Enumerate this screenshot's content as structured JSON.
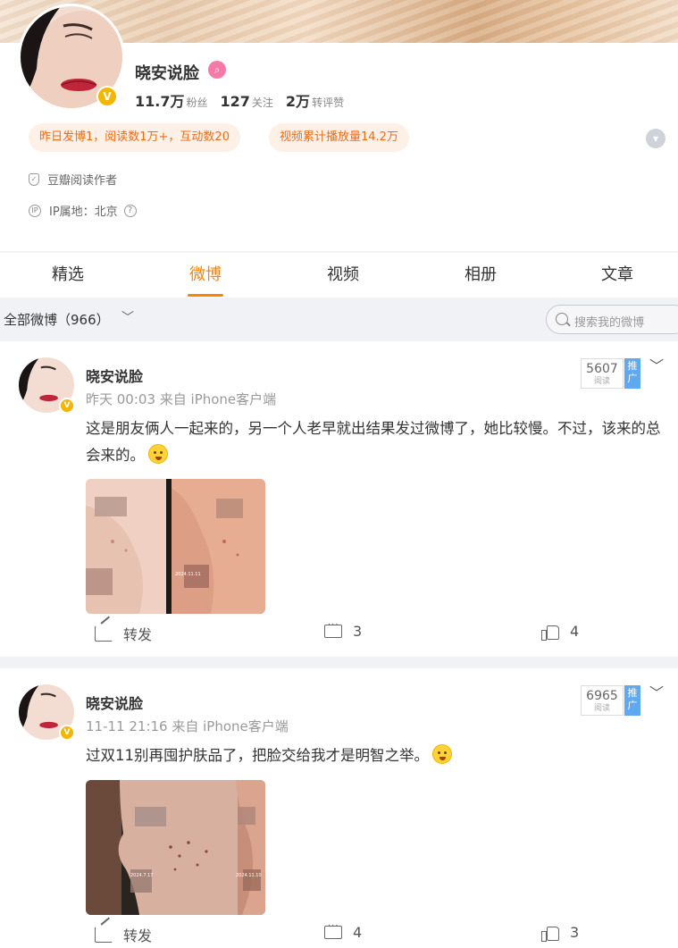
{
  "profile": {
    "name": "晓安说脸",
    "verified_badge": "V",
    "level_icon": "weibo-level-icon",
    "stats": [
      {
        "value": "11.7万",
        "label": "粉丝"
      },
      {
        "value": "127",
        "label": "关注"
      },
      {
        "value": "2万",
        "label": "转评赞"
      }
    ],
    "chips": [
      "昨日发博1，阅读数1万+，互动数20",
      "视频累计播放量14.2万"
    ],
    "info": [
      {
        "icon": "shield-icon",
        "text": "豆瓣阅读作者"
      },
      {
        "icon": "ip-icon",
        "text": "IP属地：北京",
        "help": "?"
      }
    ]
  },
  "tabs": [
    {
      "label": "精选",
      "active": false
    },
    {
      "label": "微博",
      "active": true
    },
    {
      "label": "视频",
      "active": false
    },
    {
      "label": "相册",
      "active": false
    },
    {
      "label": "文章",
      "active": false
    }
  ],
  "filter": {
    "label": "全部微博（966）",
    "chevron": "﹀",
    "search_placeholder": "搜索我的微博"
  },
  "posts": [
    {
      "author": "晓安说脸",
      "meta": "昨天 00:03 来自 iPhone客户端",
      "reads": "5607",
      "reads_label": "阅读",
      "promo": "推广",
      "text": "这是朋友俩人一起来的，另一个人老早就出结果发过微博了，她比较慢。不过，该来的总会来的。",
      "photo_labels": [
        "2024.11.11"
      ],
      "actions": {
        "share": "转发",
        "comments": "3",
        "likes": "4"
      }
    },
    {
      "author": "晓安说脸",
      "meta": "11-11 21:16 来自 iPhone客户端",
      "reads": "6965",
      "reads_label": "阅读",
      "promo": "推广",
      "text": "过双11别再囤护肤品了，把脸交给我才是明智之举。",
      "photo_labels": [
        "2024.7.17",
        "2024.11.10"
      ],
      "actions": {
        "share": "转发",
        "comments": "4",
        "likes": "3"
      }
    }
  ],
  "colors": {
    "accent": "#ff8200",
    "chip_bg": "#fdf0e6",
    "chip_text": "#f26a13",
    "verified": "#f2b705",
    "promo": "#5fa9f3"
  }
}
